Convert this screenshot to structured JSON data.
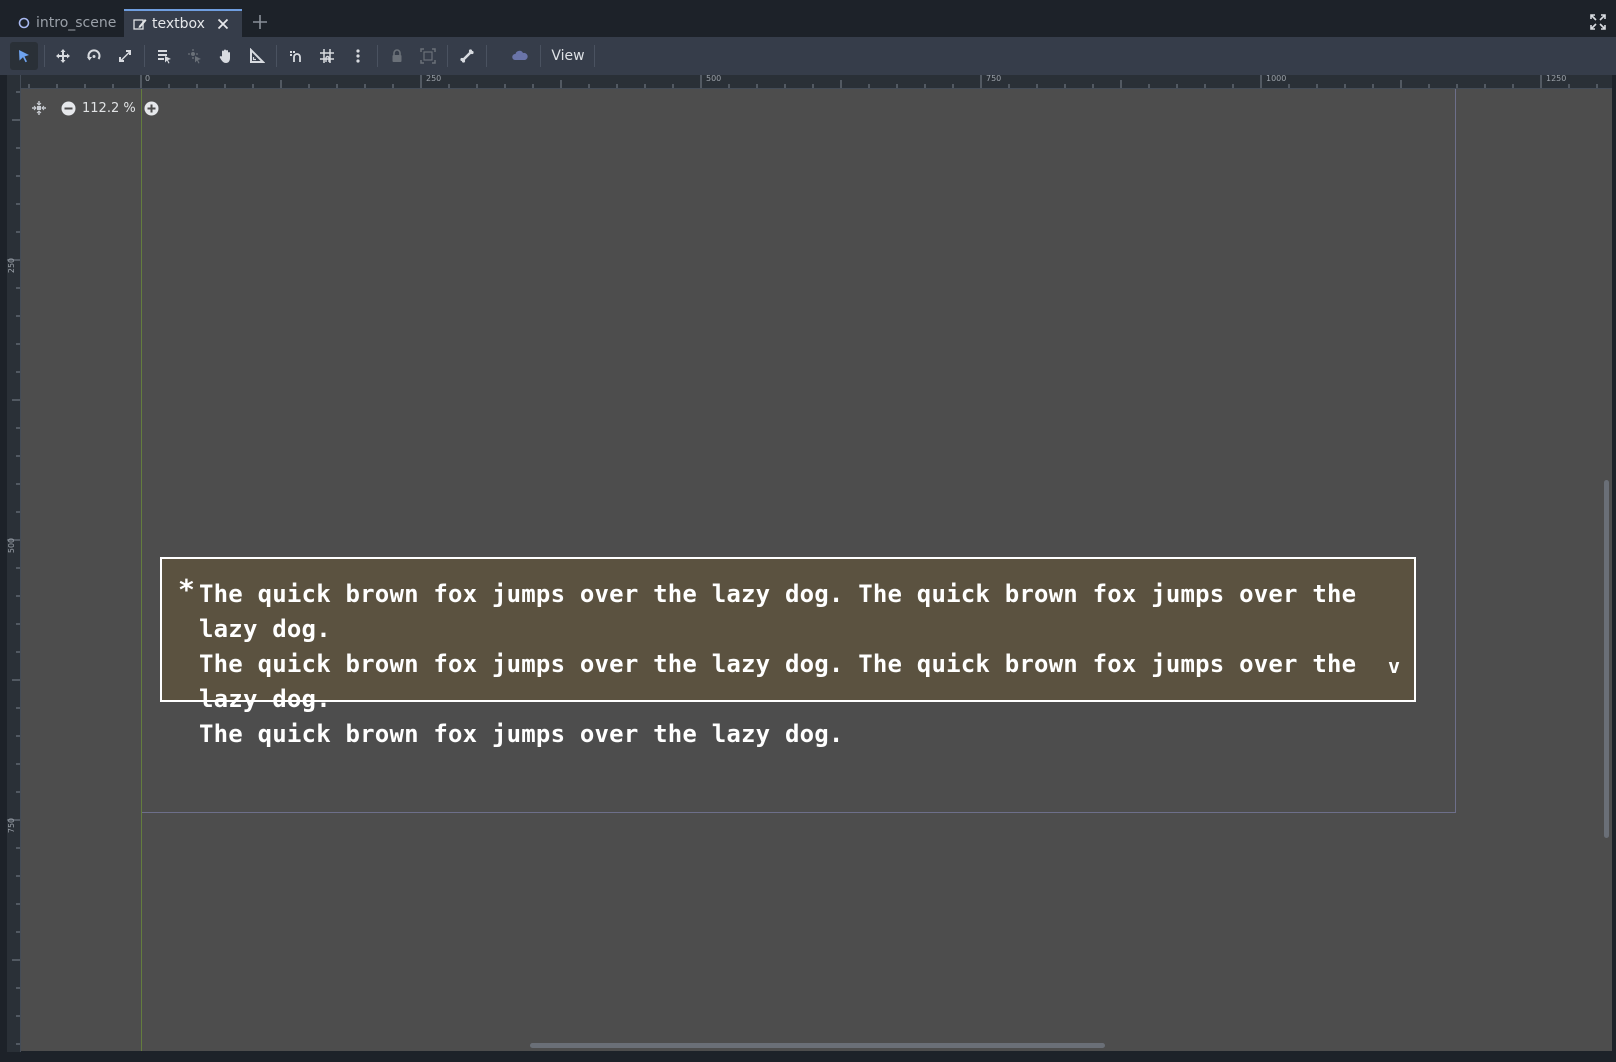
{
  "tabs": [
    {
      "label": "intro_scene",
      "icon": "scene-circle-icon",
      "active": false
    },
    {
      "label": "textbox",
      "icon": "edit-scene-icon",
      "active": true
    }
  ],
  "toolbar": {
    "view_label": "View",
    "tools": [
      "select-tool-icon",
      "move-tool-icon",
      "rotate-tool-icon",
      "scale-tool-icon",
      "list-select-icon",
      "pivot-icon",
      "pan-hand-icon",
      "ruler-icon",
      "smart-snap-icon",
      "grid-snap-icon",
      "more-options-icon",
      "lock-icon",
      "group-icon",
      "skeleton-bone-icon",
      "emitter-cloud-icon"
    ]
  },
  "ruler": {
    "top_labels": [
      "0",
      "250",
      "500",
      "750",
      "1000",
      "1250"
    ],
    "left_labels": [
      "250",
      "500",
      "750"
    ]
  },
  "zoom": {
    "level": "112.2 %"
  },
  "textbox": {
    "marker": "*",
    "lines": [
      "The quick brown fox jumps over the lazy dog. The quick brown fox jumps over the lazy dog.",
      "The quick brown fox jumps over the lazy dog. The quick brown fox jumps over the lazy dog.",
      "The quick brown fox jumps over the lazy dog."
    ],
    "continue_indicator": "v"
  },
  "colors": {
    "accent": "#6f9ee0",
    "textbox_bg": "#5b5240",
    "viewport_bg": "#4d4d4d"
  }
}
